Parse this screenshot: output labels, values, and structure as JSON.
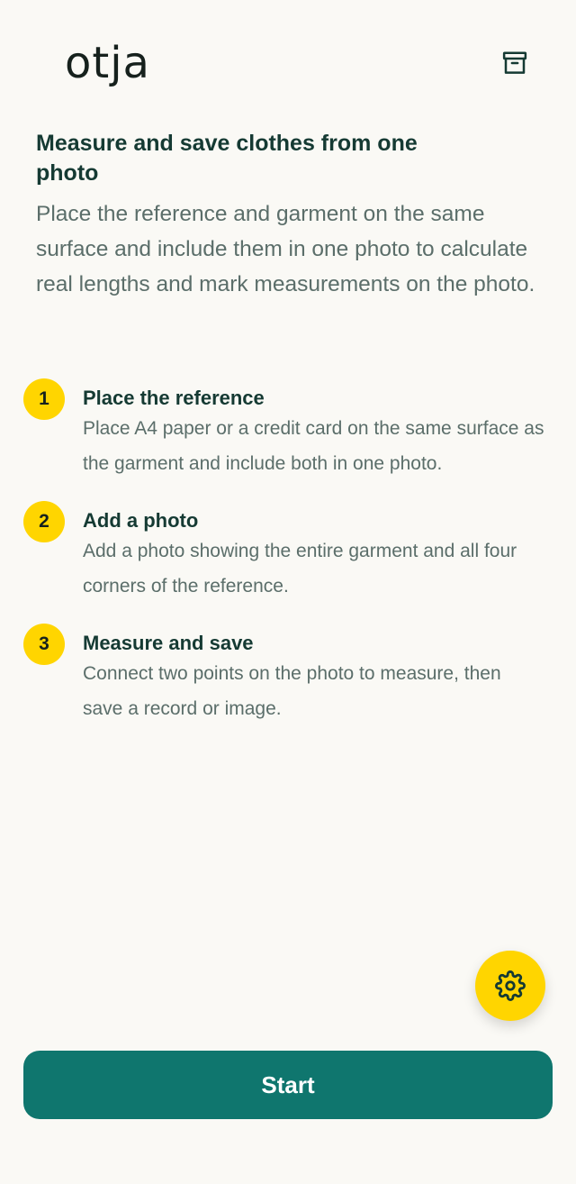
{
  "header": {
    "logo_text": "otja",
    "archive_icon": "archive-box-icon"
  },
  "intro": {
    "title": "Measure and save clothes from one photo",
    "description": "Place the reference and garment on the same surface and include them in one photo to calculate real lengths and mark measurements on the photo."
  },
  "steps": [
    {
      "number": "1",
      "title": "Place the reference",
      "description": "Place A4 paper or a credit card on the same surface as the garment and include both in one photo."
    },
    {
      "number": "2",
      "title": "Add a photo",
      "description": "Add a photo showing the entire garment and all four corners of the reference."
    },
    {
      "number": "3",
      "title": "Measure and save",
      "description": "Connect two points on the photo to measure, then save a record or image."
    }
  ],
  "fab": {
    "icon": "gear-icon"
  },
  "start_button": {
    "label": "Start"
  },
  "colors": {
    "background": "#faf9f5",
    "accent_yellow": "#ffd500",
    "primary_teal": "#0f766e",
    "heading": "#153a33",
    "body_text": "#5b6e6a"
  }
}
